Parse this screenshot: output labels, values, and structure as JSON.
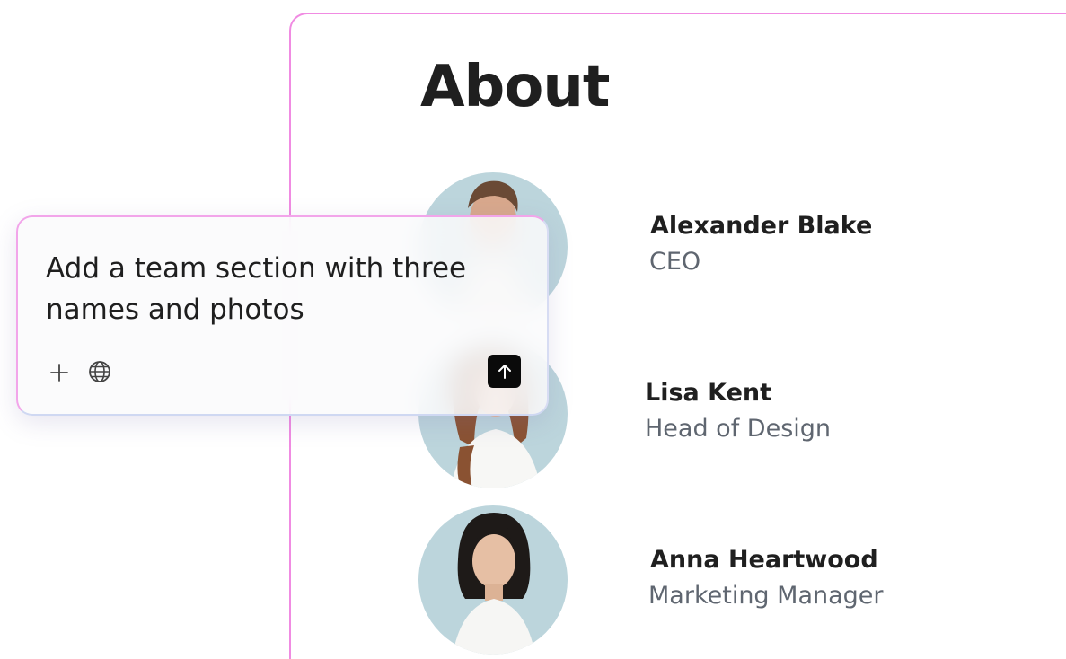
{
  "page": {
    "title": "About"
  },
  "team": [
    {
      "name": "Alexander Blake",
      "role": "CEO"
    },
    {
      "name": "Lisa Kent",
      "role": "Head of Design"
    },
    {
      "name": "Anna Heartwood",
      "role": "Marketing Manager"
    }
  ],
  "prompt": {
    "text": "Add a team section with three names and photos",
    "icons": [
      "plus-icon",
      "globe-icon",
      "arrow-up-icon"
    ]
  },
  "colors": {
    "frame_border": "#f08be2",
    "avatar_bg": "#bcd5dc",
    "role_text": "#5f6670",
    "send_button": "#0a0a0a"
  }
}
